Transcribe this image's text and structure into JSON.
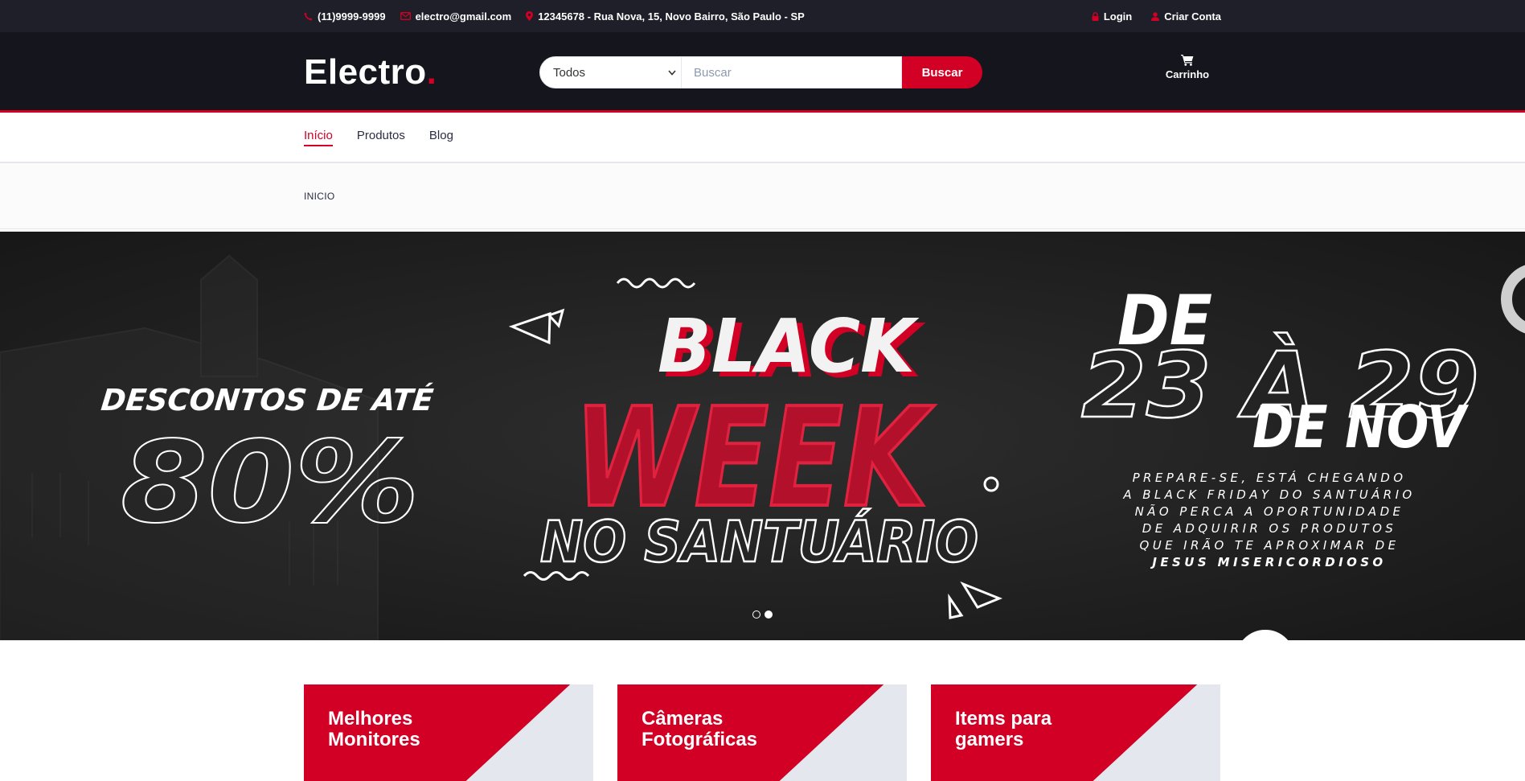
{
  "top_bar": {
    "phone": "(11)9999-9999",
    "email": "electro@gmail.com",
    "address": "12345678 - Rua Nova, 15, Novo Bairro, São Paulo - SP",
    "login": "Login",
    "create_account": "Criar Conta"
  },
  "header": {
    "logo_text": "Electro",
    "logo_dot": ".",
    "search": {
      "category_selected": "Todos",
      "placeholder": "Buscar",
      "button": "Buscar"
    },
    "cart_label": "Carrinho"
  },
  "navigation": {
    "items": [
      {
        "label": "Início",
        "active": true
      },
      {
        "label": "Produtos",
        "active": false
      },
      {
        "label": "Blog",
        "active": false
      }
    ]
  },
  "breadcrumb": {
    "current": "INICIO"
  },
  "hero": {
    "left_heading": "DESCONTOS DE ATÉ",
    "left_percent": "80%",
    "center_line1": "BLACK",
    "center_line2": "WEEK",
    "center_line3": "NO SANTUÁRIO",
    "right_de": "DE",
    "right_dates": "23 À 29",
    "right_month": "DE NOV",
    "right_text_1": "PREPARE-SE, ESTÁ CHEGANDO",
    "right_text_2": "A BLACK FRIDAY DO SANTUÁRIO",
    "right_text_3": "NÃO PERCA A OPORTUNIDADE",
    "right_text_4": "DE ADQUIRIR OS PRODUTOS",
    "right_text_5": "QUE IRÃO TE APROXIMAR DE",
    "right_text_6": "JESUS MISERICORDIOSO",
    "slide_count": 2,
    "active_slide": 2
  },
  "shop_cards": [
    {
      "line1": "Melhores",
      "line2": "Monitores"
    },
    {
      "line1": "Câmeras",
      "line2": "Fotográficas"
    },
    {
      "line1": "Items para",
      "line2": "gamers"
    }
  ],
  "colors": {
    "accent": "#d10024",
    "topbar": "#1e1f29",
    "header": "#15161d"
  },
  "icons": [
    "phone-icon",
    "envelope-icon",
    "map-marker-icon",
    "lock-icon",
    "user-icon",
    "cart-icon",
    "chevron-down-icon"
  ]
}
